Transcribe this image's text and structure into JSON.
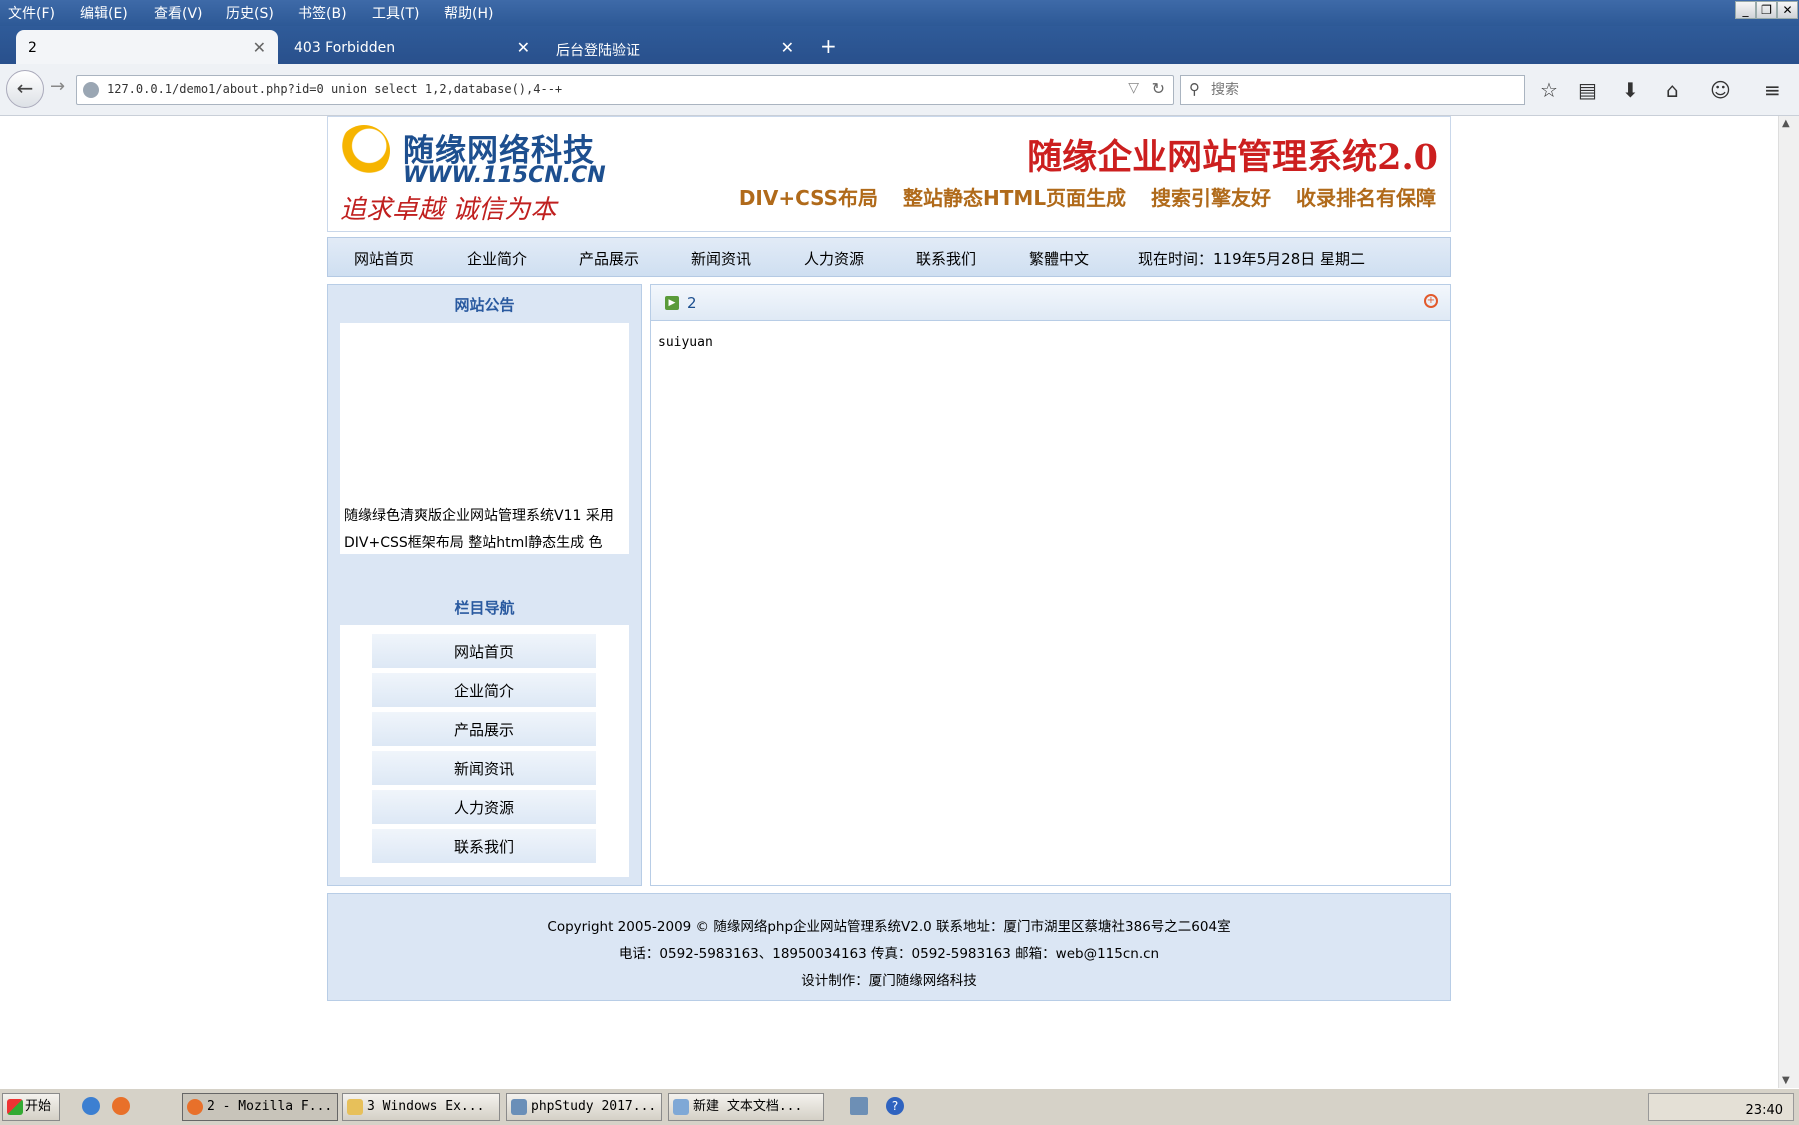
{
  "browser": {
    "menu": [
      "文件(F)",
      "编辑(E)",
      "查看(V)",
      "历史(S)",
      "书签(B)",
      "工具(T)",
      "帮助(H)"
    ],
    "tabs": [
      {
        "label": "2",
        "active": true
      },
      {
        "label": "403 Forbidden",
        "active": false
      },
      {
        "label": "后台登陆验证",
        "active": false
      }
    ],
    "url": "127.0.0.1/demo1/about.php?id=0 union select 1,2,database(),4--+",
    "search_placeholder": "搜索"
  },
  "header": {
    "logo_name": "随缘网络科技",
    "logo_url": "WWW.115CN.CN",
    "logo_motto": "追求卓越 诚信为本",
    "title": "随缘企业网站管理系统2.0",
    "slogans": [
      "DIV+CSS布局",
      "整站静态HTML页面生成",
      "搜索引擎友好",
      "收录排名有保障"
    ]
  },
  "nav": {
    "items": [
      "网站首页",
      "企业简介",
      "产品展示",
      "新闻资讯",
      "人力资源",
      "联系我们",
      "繁體中文"
    ],
    "time_text": "现在时间：119年5月28日 星期二"
  },
  "sidebar": {
    "notice_title": "网站公告",
    "notice_text": "随缘绿色清爽版企业网站管理系统V11  采用DIV+CSS框架布局 整站html静态生成 色",
    "nav_title": "栏目导航",
    "nav_items": [
      "网站首页",
      "企业简介",
      "产品展示",
      "新闻资讯",
      "人力资源",
      "联系我们"
    ]
  },
  "main": {
    "title": "2",
    "content": "suiyuan"
  },
  "footer": {
    "line1": "Copyright 2005-2009 © 随缘网络php企业网站管理系统V2.0 联系地址：厦门市湖里区蔡塘社386号之二604室",
    "line2": "电话：0592-5983163、18950034163 传真：0592-5983163 邮箱：web@115cn.cn",
    "line3": "设计制作：厦门随缘网络科技"
  },
  "taskbar": {
    "start": "开始",
    "items": [
      "2 - Mozilla F...",
      "3 Windows Ex...",
      "phpStudy 2017...",
      "新建 文本文档..."
    ],
    "clock": "23:40"
  },
  "colors": {
    "accent": "#2d5996",
    "title_red": "#cc1f1f",
    "panel": "#dbe6f4"
  }
}
